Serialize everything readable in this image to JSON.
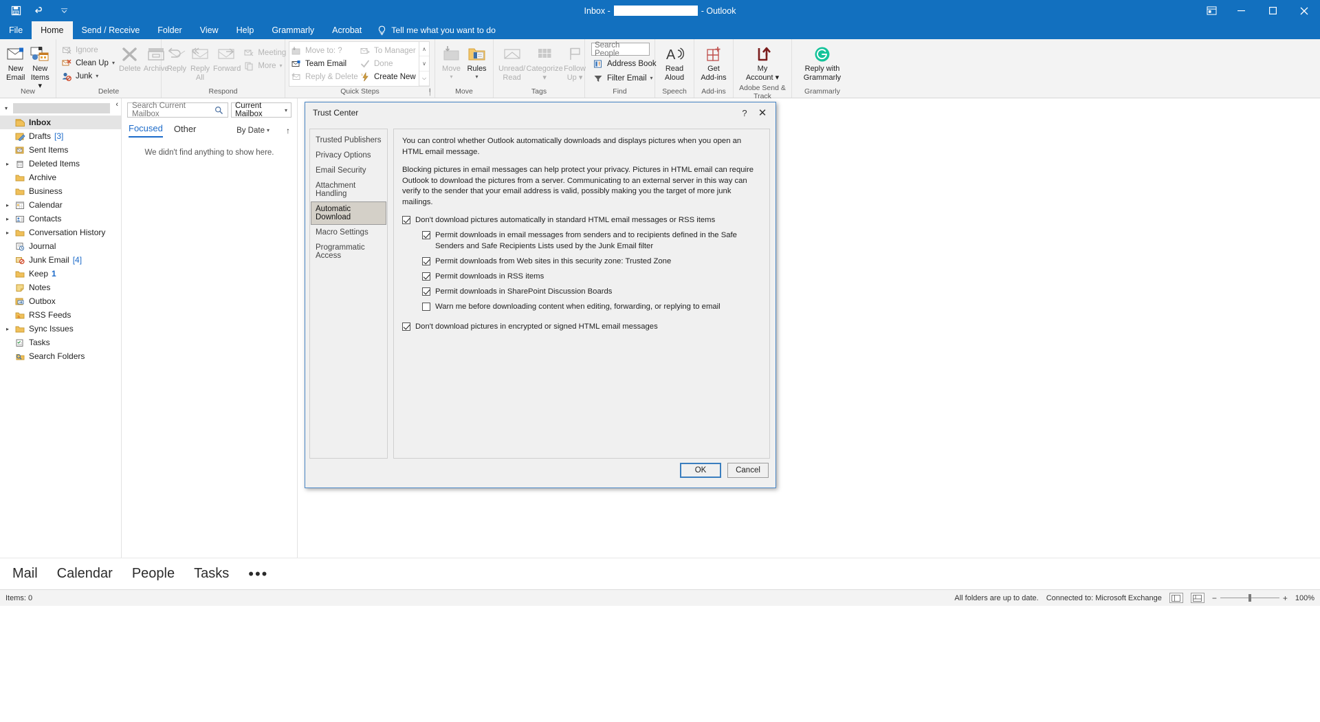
{
  "titlebar": {
    "qat": [
      {
        "name": "save-icon",
        "label": "Save"
      },
      {
        "name": "undo-icon",
        "label": "Undo"
      },
      {
        "name": "customize-qat-icon",
        "label": "Customize Quick Access Toolbar"
      }
    ],
    "title_prefix": "Inbox -",
    "title_suffix": "- Outlook",
    "window_controls": [
      {
        "name": "ribbon-display-options-icon",
        "glyph": "⬒"
      },
      {
        "name": "minimize-icon",
        "glyph": "─"
      },
      {
        "name": "maximize-icon",
        "glyph": "☐"
      },
      {
        "name": "close-icon",
        "glyph": "✕"
      }
    ]
  },
  "ribbon": {
    "tabs": [
      {
        "label": "File",
        "active": false
      },
      {
        "label": "Home",
        "active": true
      },
      {
        "label": "Send / Receive",
        "active": false
      },
      {
        "label": "Folder",
        "active": false
      },
      {
        "label": "View",
        "active": false
      },
      {
        "label": "Help",
        "active": false
      },
      {
        "label": "Grammarly",
        "active": false
      },
      {
        "label": "Acrobat",
        "active": false
      }
    ],
    "tellme": "Tell me what you want to do",
    "groups": {
      "new": {
        "label": "New",
        "items": [
          {
            "label": "New\nEmail",
            "line1": "New",
            "line2": "Email"
          },
          {
            "label": "New Items",
            "line1": "New",
            "line2": "Items ▾"
          }
        ]
      },
      "delete": {
        "label": "Delete",
        "small": [
          {
            "label": "Ignore",
            "disabled": true
          },
          {
            "label": "Clean Up",
            "caret": true,
            "disabled": false
          },
          {
            "label": "Junk",
            "caret": true,
            "disabled": false
          }
        ],
        "big": [
          {
            "line1": "Delete",
            "disabled": true
          },
          {
            "line1": "Archive",
            "disabled": true
          }
        ]
      },
      "respond": {
        "label": "Respond",
        "big": [
          {
            "line1": "Reply",
            "disabled": true
          },
          {
            "line1": "Reply",
            "line2": "All",
            "disabled": true
          },
          {
            "line1": "Forward",
            "disabled": true
          }
        ],
        "small": [
          {
            "label": "Meeting",
            "disabled": true
          },
          {
            "label": "More",
            "caret": true,
            "disabled": true
          }
        ]
      },
      "quicksteps": {
        "label": "Quick Steps",
        "col1": [
          {
            "label": "Move to: ?",
            "disabled": true
          },
          {
            "label": "Team Email",
            "disabled": false
          },
          {
            "label": "Reply & Delete",
            "disabled": true
          }
        ],
        "col2": [
          {
            "label": "To Manager",
            "disabled": true
          },
          {
            "label": "Done",
            "disabled": true
          },
          {
            "label": "Create New",
            "disabled": false
          }
        ],
        "scroll": [
          "∧",
          "∨",
          "⌵"
        ]
      },
      "move": {
        "label": "Move",
        "big": [
          {
            "line1": "Move",
            "line2": "▾",
            "disabled": true
          },
          {
            "line1": "Rules",
            "line2": "▾",
            "disabled": false
          }
        ]
      },
      "tags": {
        "label": "Tags",
        "big": [
          {
            "line1": "Unread/",
            "line2": "Read",
            "disabled": true
          },
          {
            "line1": "Categorize",
            "line2": "▾",
            "disabled": true
          },
          {
            "line1": "Follow",
            "line2": "Up ▾",
            "disabled": true
          }
        ]
      },
      "find": {
        "label": "Find",
        "search_placeholder": "Search People",
        "small": [
          {
            "label": "Address Book",
            "caret": false
          },
          {
            "label": "Filter Email",
            "caret": true
          }
        ]
      },
      "speech": {
        "label": "Speech",
        "big": [
          {
            "line1": "Read",
            "line2": "Aloud"
          }
        ]
      },
      "addins": {
        "label": "Add-ins",
        "big": [
          {
            "line1": "Get",
            "line2": "Add-ins"
          }
        ]
      },
      "adobe": {
        "label": "Adobe Send & Track",
        "big": [
          {
            "line1": "My",
            "line2": "Account ▾"
          }
        ]
      },
      "grammarly": {
        "label": "Grammarly",
        "big": [
          {
            "line1": "Reply with",
            "line2": "Grammarly"
          }
        ]
      }
    }
  },
  "navpane": {
    "collapse_glyph": "‹",
    "folders": [
      {
        "label": "Inbox",
        "icon": "inbox-icon",
        "selected": true,
        "expand": false,
        "count": ""
      },
      {
        "label": "Drafts",
        "icon": "drafts-icon",
        "selected": false,
        "expand": false,
        "count": "[3]"
      },
      {
        "label": "Sent Items",
        "icon": "sent-icon",
        "selected": false,
        "expand": false,
        "count": ""
      },
      {
        "label": "Deleted Items",
        "icon": "deleted-icon",
        "selected": false,
        "expand": true,
        "count": ""
      },
      {
        "label": "Archive",
        "icon": "folder-icon",
        "selected": false,
        "expand": false,
        "count": ""
      },
      {
        "label": "Business",
        "icon": "folder-icon",
        "selected": false,
        "expand": false,
        "count": ""
      },
      {
        "label": "Calendar",
        "icon": "calendar-icon",
        "selected": false,
        "expand": true,
        "count": ""
      },
      {
        "label": "Contacts",
        "icon": "contacts-icon",
        "selected": false,
        "expand": true,
        "count": ""
      },
      {
        "label": "Conversation History",
        "icon": "folder-icon",
        "selected": false,
        "expand": true,
        "count": ""
      },
      {
        "label": "Journal",
        "icon": "journal-icon",
        "selected": false,
        "expand": false,
        "count": ""
      },
      {
        "label": "Junk Email",
        "icon": "junk-icon",
        "selected": false,
        "expand": false,
        "count": "[4]"
      },
      {
        "label": "Keep",
        "icon": "folder-icon",
        "selected": false,
        "expand": false,
        "count": "1",
        "bold_count": true
      },
      {
        "label": "Notes",
        "icon": "notes-icon",
        "selected": false,
        "expand": false,
        "count": ""
      },
      {
        "label": "Outbox",
        "icon": "outbox-icon",
        "selected": false,
        "expand": false,
        "count": ""
      },
      {
        "label": "RSS Feeds",
        "icon": "rss-icon",
        "selected": false,
        "expand": false,
        "count": ""
      },
      {
        "label": "Sync Issues",
        "icon": "folder-icon",
        "selected": false,
        "expand": true,
        "count": ""
      },
      {
        "label": "Tasks",
        "icon": "tasks-icon",
        "selected": false,
        "expand": false,
        "count": ""
      },
      {
        "label": "Search Folders",
        "icon": "search-folders-icon",
        "selected": false,
        "expand": false,
        "count": ""
      }
    ]
  },
  "listpane": {
    "search_placeholder": "Search Current Mailbox",
    "scope": "Current Mailbox",
    "tab_focused": "Focused",
    "tab_other": "Other",
    "sort_label": "By Date",
    "empty_message": "We didn't find anything to show here."
  },
  "dialog": {
    "title": "Trust Center",
    "help_glyph": "?",
    "close_glyph": "✕",
    "nav": [
      {
        "label": "Trusted Publishers",
        "active": false
      },
      {
        "label": "Privacy Options",
        "active": false
      },
      {
        "label": "Email Security",
        "active": false
      },
      {
        "label": "Attachment Handling",
        "active": false
      },
      {
        "label": "Automatic Download",
        "active": true
      },
      {
        "label": "Macro Settings",
        "active": false
      },
      {
        "label": "Programmatic Access",
        "active": false
      }
    ],
    "paragraphs": [
      "You can control whether Outlook automatically downloads and displays pictures when you open an HTML email message.",
      "Blocking pictures in email messages can help protect your privacy. Pictures in HTML email can require Outlook to download the pictures from a server. Communicating to an external server in this way can verify to the sender that your email address is valid, possibly making you the target of more junk mailings."
    ],
    "checkboxes": [
      {
        "label": "Don't download pictures automatically in standard HTML email messages or RSS items",
        "checked": true,
        "indent": false,
        "accel": "D"
      },
      {
        "label": "Permit downloads in email messages from senders and to recipients defined in the Safe Senders and Safe Recipients Lists used by the Junk Email filter",
        "checked": true,
        "indent": true,
        "accel": ""
      },
      {
        "label": "Permit downloads from Web sites in this security zone: Trusted Zone",
        "checked": true,
        "indent": true,
        "accel": "P"
      },
      {
        "label": "Permit downloads in RSS items",
        "checked": true,
        "indent": true,
        "accel": "R"
      },
      {
        "label": "Permit downloads in SharePoint Discussion Boards",
        "checked": true,
        "indent": true,
        "accel": "B"
      },
      {
        "label": "Warn me before downloading content when editing, forwarding, or replying to email",
        "checked": false,
        "indent": true,
        "accel": "W"
      },
      {
        "label": "Don't download pictures in encrypted or signed HTML email messages",
        "checked": true,
        "indent": false,
        "accel": ""
      }
    ],
    "buttons": {
      "ok": "OK",
      "cancel": "Cancel"
    }
  },
  "bottomnav": {
    "items": [
      {
        "label": "Mail"
      },
      {
        "label": "Calendar"
      },
      {
        "label": "People"
      },
      {
        "label": "Tasks"
      },
      {
        "label": "•••"
      }
    ]
  },
  "statusbar": {
    "items_count": "Items: 0",
    "folders_status": "All folders are up to date.",
    "connection": "Connected to: Microsoft Exchange",
    "zoom_level": "100%",
    "zoom_minus": "−",
    "zoom_plus": "+"
  }
}
